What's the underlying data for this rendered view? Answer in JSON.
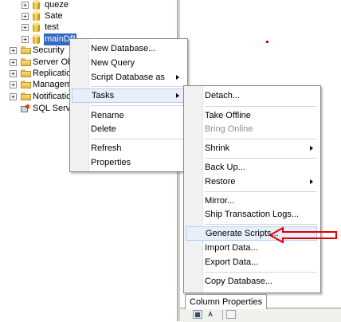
{
  "tree": {
    "databases": [
      {
        "label": "queze"
      },
      {
        "label": "Sate"
      },
      {
        "label": "test"
      },
      {
        "label": "mainDB",
        "selected": true
      }
    ],
    "folders": [
      {
        "label": "Security"
      },
      {
        "label": "Server Obje"
      },
      {
        "label": "Replication"
      },
      {
        "label": "Manageme"
      },
      {
        "label": "Notification"
      }
    ],
    "agent": {
      "label": "SQL Server"
    }
  },
  "context_menu": {
    "new_database": "New Database...",
    "new_query": "New Query",
    "script_database_as": "Script Database as",
    "tasks": "Tasks",
    "rename": "Rename",
    "delete": "Delete",
    "refresh": "Refresh",
    "properties": "Properties"
  },
  "tasks_menu": {
    "detach": "Detach...",
    "take_offline": "Take Offline",
    "bring_online": "Bring Online",
    "shrink": "Shrink",
    "back_up": "Back Up...",
    "restore": "Restore",
    "mirror": "Mirror...",
    "ship_transaction_logs": "Ship Transaction Logs...",
    "generate_scripts": "Generate Scripts...",
    "import_data": "Import Data...",
    "export_data": "Export Data...",
    "copy_database": "Copy Database..."
  },
  "column_properties": {
    "tab_label": "Column Properties",
    "toolbar_icons": [
      "categorized-icon",
      "alphabetical-icon",
      "property-pages-icon"
    ],
    "alphabetical_glyph": "A"
  },
  "colors": {
    "selection": "#316ac5",
    "highlight": "#e8effb",
    "annotation_arrow": "#e00000"
  }
}
